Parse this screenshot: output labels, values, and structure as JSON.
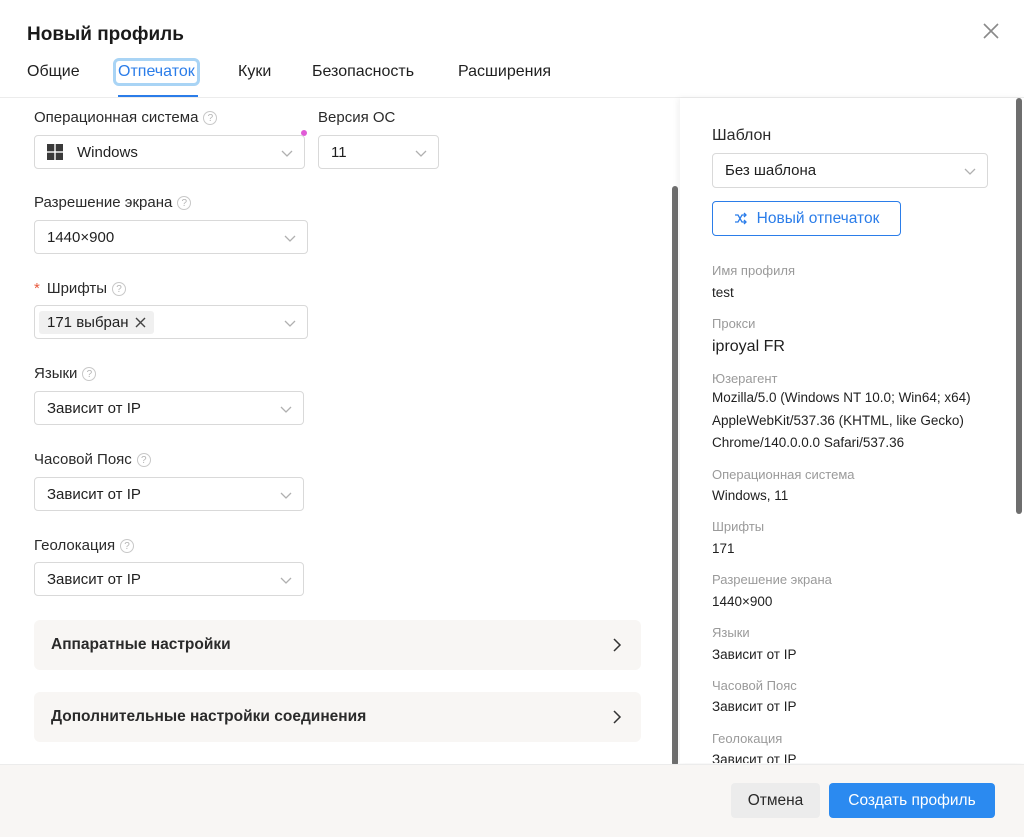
{
  "dialog": {
    "title": "Новый профиль"
  },
  "tabs": [
    {
      "label": "Общие"
    },
    {
      "label": "Отпечаток",
      "active": true
    },
    {
      "label": "Куки"
    },
    {
      "label": "Безопасность"
    },
    {
      "label": "Расширения"
    }
  ],
  "form": {
    "os": {
      "label": "Операционная система",
      "value": "Windows",
      "icon": "windows-icon"
    },
    "os_version": {
      "label": "Версия ОС",
      "value": "11"
    },
    "resolution": {
      "label": "Разрешение экрана",
      "value": "1440×900"
    },
    "fonts": {
      "label": "Шрифты",
      "required_mark": "*",
      "tag": "171 выбран"
    },
    "languages": {
      "label": "Языки",
      "value": "Зависит от IP"
    },
    "timezone": {
      "label": "Часовой Пояс",
      "value": "Зависит от IP"
    },
    "geolocation": {
      "label": "Геолокация",
      "value": "Зависит от IP"
    },
    "help_glyph": "?"
  },
  "sections": {
    "hardware": "Аппаратные настройки",
    "connection": "Дополнительные настройки соединения"
  },
  "summary": {
    "template_label": "Шаблон",
    "template_value": "Без шаблона",
    "new_fingerprint_button": "Новый отпечаток",
    "items": [
      {
        "key": "Имя профиля",
        "value": "test"
      },
      {
        "key": "Прокси",
        "value": "iproyal FR"
      },
      {
        "key": "Юзерагент",
        "value_lines": [
          "Mozilla/5.0 (Windows NT 10.0; Win64; x64)",
          "AppleWebKit/537.36 (KHTML, like Gecko)",
          "Chrome/140.0.0.0 Safari/537.36"
        ]
      },
      {
        "key": "Операционная система",
        "value": "Windows, 11"
      },
      {
        "key": "Шрифты",
        "value": "171"
      },
      {
        "key": "Разрешение экрана",
        "value": "1440×900"
      },
      {
        "key": "Языки",
        "value": "Зависит от IP"
      },
      {
        "key": "Часовой Пояс",
        "value": "Зависит от IP"
      },
      {
        "key": "Геолокация",
        "value": "Зависит от IP"
      }
    ]
  },
  "footer": {
    "cancel": "Отмена",
    "create": "Создать профиль"
  },
  "colors": {
    "accent": "#2b7de9",
    "primary_button": "#2b8af0",
    "required": "#e8593c",
    "panel_bg": "#f8f6f4"
  }
}
